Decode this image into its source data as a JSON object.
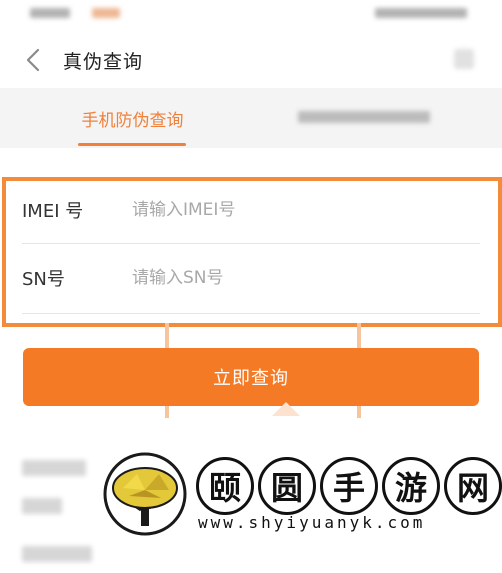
{
  "nav": {
    "title": "真伪查询"
  },
  "tabs": {
    "active_label": "手机防伪查询"
  },
  "form": {
    "imei": {
      "label": "IMEI 号",
      "placeholder": "请输入IMEI号",
      "value": ""
    },
    "sn": {
      "label": "SN号",
      "placeholder": "请输入SN号",
      "value": ""
    }
  },
  "action": {
    "query_label": "立即查询"
  },
  "watermark": {
    "chars": [
      "颐",
      "圆",
      "手",
      "游",
      "网"
    ],
    "url": "www.shyiyuanyk.com"
  },
  "colors": {
    "accent": "#f0803a",
    "button": "#f47a25",
    "highlight_border": "#f28c3c"
  }
}
